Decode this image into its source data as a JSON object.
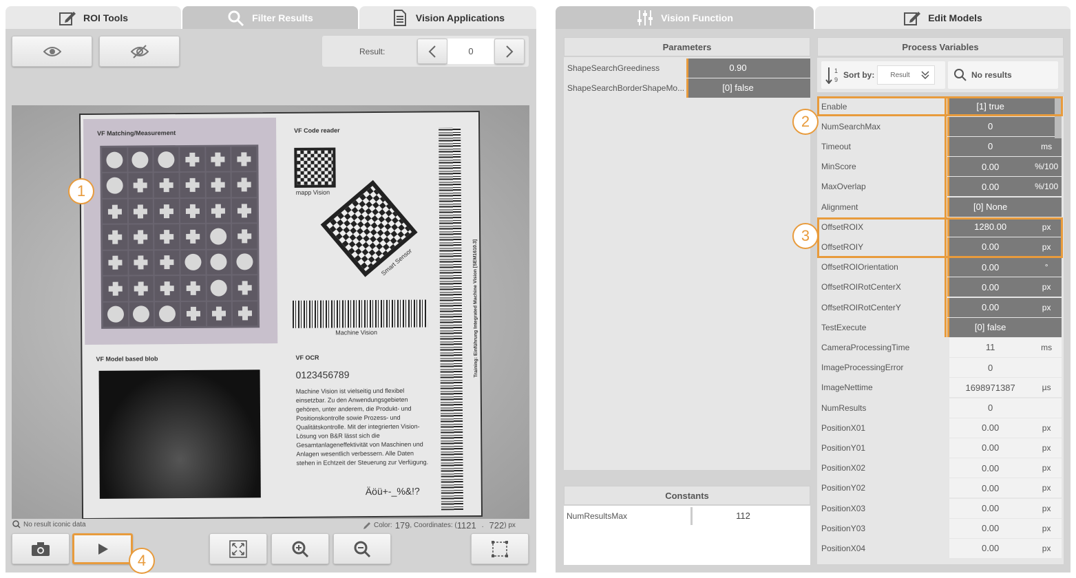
{
  "tabs_left": [
    {
      "label": "ROI Tools",
      "icon": "edit-icon"
    },
    {
      "label": "Filter Results",
      "icon": "search-icon"
    },
    {
      "label": "Vision Applications",
      "icon": "document-icon"
    }
  ],
  "tabs_right": [
    {
      "label": "Vision Function",
      "icon": "sliders-icon"
    },
    {
      "label": "Edit Models",
      "icon": "edit-icon"
    }
  ],
  "result": {
    "label": "Result:",
    "value": "0"
  },
  "status": {
    "left": "No result iconic data",
    "color_label": "Color:",
    "color_value": "179",
    "coords_label": ", Coordinates: (",
    "x": "1121",
    "y": "722",
    "coords_end": ") px"
  },
  "image_text": {
    "vf_matching": "VF Matching/Measurement",
    "vf_code": "VF Code reader",
    "mapp": "mapp Vision",
    "smart": "Smart Sensor",
    "mv": "Machine Vision",
    "vf_blob": "VF Model based blob",
    "vf_ocr": "VF OCR",
    "ocr_num": "0123456789",
    "ocr_para": "Machine Vision ist vielseitig und flexibel einsetzbar. Zu den Anwendungsgebieten gehören, unter anderem, die Produkt- und Positionskontrolle sowie Prozess- und Qualitätskontrolle. Mit der integrierten Vision-Lösung von B&R lässt sich die Gesamtanlageneffektivität von Maschinen und Anlagen wesentlich verbessern. Alle Daten stehen in Echtzeit der Steuerung zur Verfügung.",
    "special": "Äöü+-_%&!?",
    "vertical": "Training: Einführung Integrated Machine Vision [SEM1610.3]"
  },
  "markers": [
    "1",
    "2",
    "3",
    "4"
  ],
  "parameters": {
    "title": "Parameters",
    "rows": [
      {
        "name": "ShapeSearchGreediness",
        "value": "0.90"
      },
      {
        "name": "ShapeSearchBorderShapeMo...",
        "value": "[0] false"
      }
    ]
  },
  "constants": {
    "title": "Constants",
    "rows": [
      {
        "name": "NumResultsMax",
        "value": "112"
      }
    ]
  },
  "process": {
    "title": "Process Variables",
    "sort_label": "Sort by:",
    "sort_value": "Result",
    "search_text": "No results",
    "rows": [
      {
        "name": "Enable",
        "value": "[1] true",
        "unit": "",
        "edit": true
      },
      {
        "name": "NumSearchMax",
        "value": "0",
        "unit": "",
        "edit": true
      },
      {
        "name": "Timeout",
        "value": "0",
        "unit": "ms",
        "edit": true
      },
      {
        "name": "MinScore",
        "value": "0.00",
        "unit": "%/100",
        "edit": true
      },
      {
        "name": "MaxOverlap",
        "value": "0.00",
        "unit": "%/100",
        "edit": true
      },
      {
        "name": "Alignment",
        "value": "[0] None",
        "unit": "",
        "edit": true
      },
      {
        "name": "OffsetROIX",
        "value": "1280.00",
        "unit": "px",
        "edit": true
      },
      {
        "name": "OffsetROIY",
        "value": "0.00",
        "unit": "px",
        "edit": true
      },
      {
        "name": "OffsetROIOrientation",
        "value": "0.00",
        "unit": "°",
        "edit": true
      },
      {
        "name": "OffsetROIRotCenterX",
        "value": "0.00",
        "unit": "px",
        "edit": true
      },
      {
        "name": "OffsetROIRotCenterY",
        "value": "0.00",
        "unit": "px",
        "edit": true
      },
      {
        "name": "TestExecute",
        "value": "[0] false",
        "unit": "",
        "edit": true
      },
      {
        "name": "CameraProcessingTime",
        "value": "11",
        "unit": "ms",
        "edit": false
      },
      {
        "name": "ImageProcessingError",
        "value": "0",
        "unit": "",
        "edit": false
      },
      {
        "name": "ImageNettime",
        "value": "1698971387",
        "unit": "µs",
        "edit": false
      },
      {
        "name": "NumResults",
        "value": "0",
        "unit": "",
        "edit": false
      },
      {
        "name": "PositionX01",
        "value": "0.00",
        "unit": "px",
        "edit": false
      },
      {
        "name": "PositionY01",
        "value": "0.00",
        "unit": "px",
        "edit": false
      },
      {
        "name": "PositionX02",
        "value": "0.00",
        "unit": "px",
        "edit": false
      },
      {
        "name": "PositionY02",
        "value": "0.00",
        "unit": "px",
        "edit": false
      },
      {
        "name": "PositionX03",
        "value": "0.00",
        "unit": "px",
        "edit": false
      },
      {
        "name": "PositionY03",
        "value": "0.00",
        "unit": "px",
        "edit": false
      },
      {
        "name": "PositionX04",
        "value": "0.00",
        "unit": "px",
        "edit": false
      }
    ]
  }
}
